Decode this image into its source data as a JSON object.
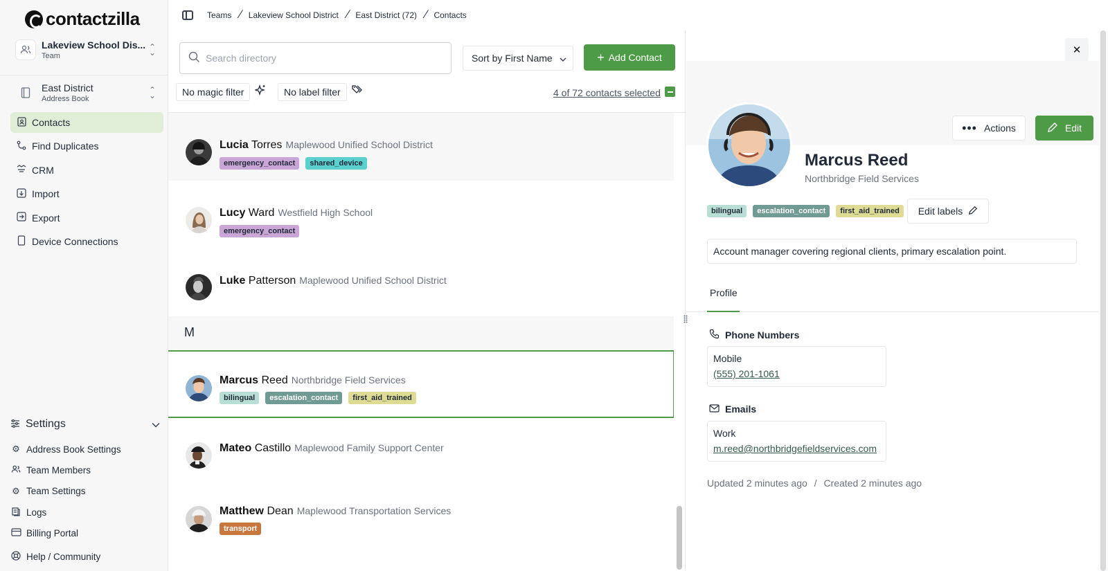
{
  "app": {
    "logo": "contactzilla"
  },
  "team_switcher": {
    "title": "Lakeview School Dis...",
    "subtitle": "Team"
  },
  "book_switcher": {
    "title": "East District",
    "subtitle": "Address Book"
  },
  "nav": [
    {
      "label": "Contacts",
      "icon": "contacts-icon",
      "active": true
    },
    {
      "label": "Find Duplicates",
      "icon": "merge-icon"
    },
    {
      "label": "CRM",
      "icon": "crm-icon"
    },
    {
      "label": "Import",
      "icon": "import-icon"
    },
    {
      "label": "Export",
      "icon": "export-icon"
    },
    {
      "label": "Device Connections",
      "icon": "device-icon"
    }
  ],
  "settings": {
    "title": "Settings",
    "items": [
      {
        "label": "Address Book Settings"
      },
      {
        "label": "Team Members"
      },
      {
        "label": "Team Settings"
      },
      {
        "label": "Logs"
      },
      {
        "label": "Billing Portal"
      }
    ],
    "help": "Help / Community"
  },
  "breadcrumb": [
    "Teams",
    "Lakeview School District",
    "East District (72)",
    "Contacts"
  ],
  "toolbar": {
    "search_placeholder": "Search directory",
    "sort_label": "Sort by First Name",
    "add_label": "Add Contact",
    "magic_filter": "No magic filter",
    "label_filter": "No label filter",
    "selected_text": "4 of 72 contacts selected"
  },
  "contacts": [
    {
      "first": "Lucia",
      "last": "Torres",
      "org": "Maplewood Unified School District",
      "tags": [
        "emergency_contact",
        "shared_device"
      ]
    },
    {
      "first": "Lucy",
      "last": "Ward",
      "org": "Westfield High School",
      "tags": [
        "emergency_contact"
      ]
    },
    {
      "first": "Luke",
      "last": "Patterson",
      "org": "Maplewood Unified School District",
      "tags": []
    },
    {
      "first": "Marcus",
      "last": "Reed",
      "org": "Northbridge Field Services",
      "tags": [
        "bilingual",
        "escalation_contact",
        "first_aid_trained"
      ]
    },
    {
      "first": "Mateo",
      "last": "Castillo",
      "org": "Maplewood Family Support Center",
      "tags": []
    },
    {
      "first": "Matthew",
      "last": "Dean",
      "org": "Maplewood Transportation Services",
      "tags": [
        "transport"
      ]
    }
  ],
  "section_letter": "M",
  "tag_colors": {
    "emergency_contact": "#c9a6d6",
    "shared_device": "#5ccfcf",
    "bilingual": "#b8ded5",
    "escalation_contact": "#6f9b94",
    "first_aid_trained": "#dedb94",
    "transport": "#c9773f"
  },
  "detail": {
    "name": "Marcus Reed",
    "org": "Northbridge Field Services",
    "actions_label": "Actions",
    "edit_label": "Edit",
    "tags": [
      "bilingual",
      "escalation_contact",
      "first_aid_trained"
    ],
    "edit_labels": "Edit labels",
    "note": "Account manager covering regional clients, primary escalation point.",
    "tab": "Profile",
    "phone_title": "Phone Numbers",
    "phone_label": "Mobile",
    "phone_value": "(555) 201-1061",
    "email_title": "Emails",
    "email_label": "Work",
    "email_value": "m.reed@northbridgefieldservices.com",
    "updated": "Updated 2 minutes ago",
    "created": "Created 2 minutes ago",
    "ts_sep": "/"
  }
}
